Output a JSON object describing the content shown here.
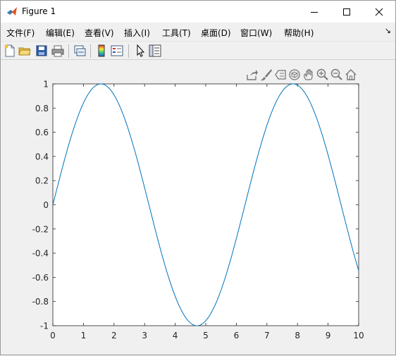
{
  "window": {
    "title": "Figure 1",
    "minimize_glyph": "—",
    "maximize_glyph": "☐",
    "close_glyph": "✕"
  },
  "menu": {
    "items": [
      {
        "label": "文件(F)"
      },
      {
        "label": "编辑(E)"
      },
      {
        "label": "查看(V)"
      },
      {
        "label": "插入(I)"
      },
      {
        "label": "工具(T)"
      },
      {
        "label": "桌面(D)"
      },
      {
        "label": "窗口(W)"
      },
      {
        "label": "帮助(H)"
      }
    ],
    "overflow_glyph": "↘"
  },
  "toolbar": {
    "icons": [
      "new-figure-icon",
      "open-file-icon",
      "save-icon",
      "print-icon",
      "link-plot-icon",
      "colorbar-icon",
      "legend-icon",
      "pointer-icon",
      "property-inspector-icon"
    ]
  },
  "axes_toolbar": {
    "icons": [
      "export-icon",
      "brush-icon",
      "data-tips-icon",
      "rotate-3d-icon",
      "pan-icon",
      "zoom-in-icon",
      "zoom-out-icon",
      "home-icon"
    ]
  },
  "colors": {
    "line": "#0072bd",
    "axes_bg": "#ffffff",
    "figure_bg": "#f0f0f0"
  },
  "chart_data": {
    "type": "line",
    "function": "sin(x)",
    "xlim": [
      0,
      10
    ],
    "ylim": [
      -1,
      1
    ],
    "x_ticks": [
      "0",
      "1",
      "2",
      "3",
      "4",
      "5",
      "6",
      "7",
      "8",
      "9",
      "10"
    ],
    "y_ticks": [
      "-1",
      "-0.8",
      "-0.6",
      "-0.4",
      "-0.2",
      "0",
      "0.2",
      "0.4",
      "0.6",
      "0.8",
      "1"
    ],
    "x_tick_values": [
      0,
      1,
      2,
      3,
      4,
      5,
      6,
      7,
      8,
      9,
      10
    ],
    "y_tick_values": [
      -1,
      -0.8,
      -0.6,
      -0.4,
      -0.2,
      0,
      0.2,
      0.4,
      0.6,
      0.8,
      1
    ],
    "series": [
      {
        "x": [
          0,
          0.5,
          1,
          1.5,
          1.5708,
          2,
          2.5,
          3,
          3.5,
          4,
          4.5,
          4.7124,
          5,
          5.5,
          6,
          6.5,
          7,
          7.5,
          7.854,
          8,
          8.5,
          9,
          9.5,
          10
        ],
        "y": [
          0,
          0.479,
          0.841,
          0.997,
          1,
          0.909,
          0.598,
          0.141,
          -0.351,
          -0.757,
          -0.978,
          -1,
          -0.959,
          -0.706,
          -0.279,
          0.215,
          0.657,
          0.938,
          1,
          0.989,
          0.798,
          0.412,
          -0.075,
          -0.544
        ]
      }
    ],
    "grid": false
  }
}
